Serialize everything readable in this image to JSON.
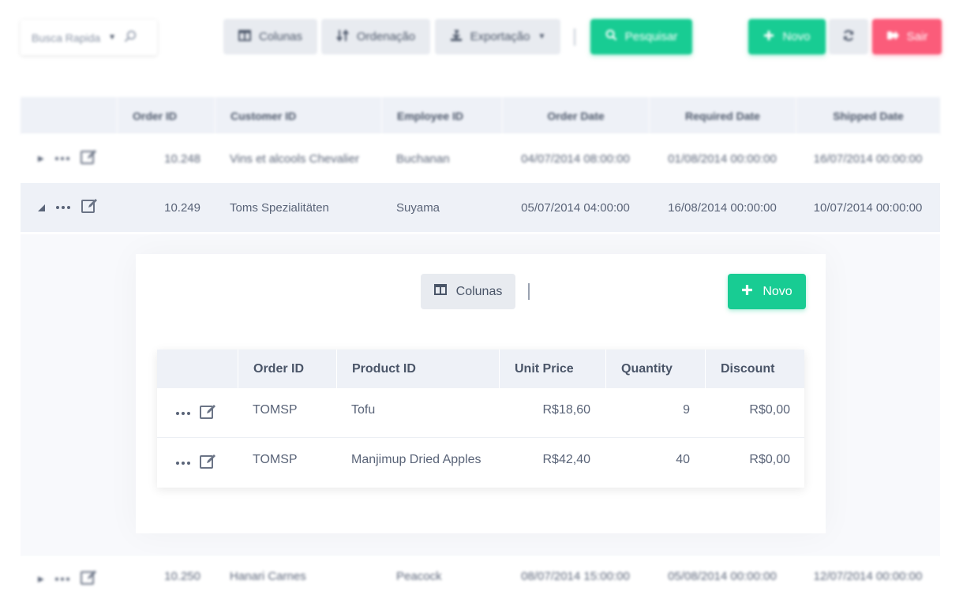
{
  "toolbar": {
    "quick_search": "Busca Rapida",
    "columns": "Colunas",
    "sort": "Ordenação",
    "export": "Exportação",
    "search": "Pesquisar",
    "new": "Novo",
    "logout": "Sair"
  },
  "grid": {
    "headers": [
      "Order ID",
      "Customer ID",
      "Employee ID",
      "Order Date",
      "Required Date",
      "Shipped Date"
    ],
    "rows": [
      {
        "order_id": "10.248",
        "customer": "Vins et alcools Chevalier",
        "employee": "Buchanan",
        "order_date": "04/07/2014 08:00:00",
        "required": "01/08/2014 00:00:00",
        "shipped": "16/07/2014 00:00:00"
      },
      {
        "order_id": "10.249",
        "customer": "Toms Spezialitäten",
        "employee": "Suyama",
        "order_date": "05/07/2014 04:00:00",
        "required": "16/08/2014 00:00:00",
        "shipped": "10/07/2014 00:00:00"
      },
      {
        "order_id": "10.250",
        "customer": "Hanari Carnes",
        "employee": "Peacock",
        "order_date": "08/07/2014 15:00:00",
        "required": "05/08/2014 00:00:00",
        "shipped": "12/07/2014 00:00:00"
      }
    ]
  },
  "detail": {
    "columns": "Colunas",
    "new": "Novo",
    "headers": [
      "Order ID",
      "Product ID",
      "Unit Price",
      "Quantity",
      "Discount"
    ],
    "rows": [
      {
        "order_id": "TOMSP",
        "product": "Tofu",
        "unit_price": "R$18,60",
        "quantity": "9",
        "discount": "R$0,00"
      },
      {
        "order_id": "TOMSP",
        "product": "Manjimup Dried Apples",
        "unit_price": "R$42,40",
        "quantity": "40",
        "discount": "R$0,00"
      }
    ]
  },
  "colors": {
    "primary": "#18cc93",
    "danger": "#fb5c7a",
    "header_bg": "#eef1f7"
  }
}
